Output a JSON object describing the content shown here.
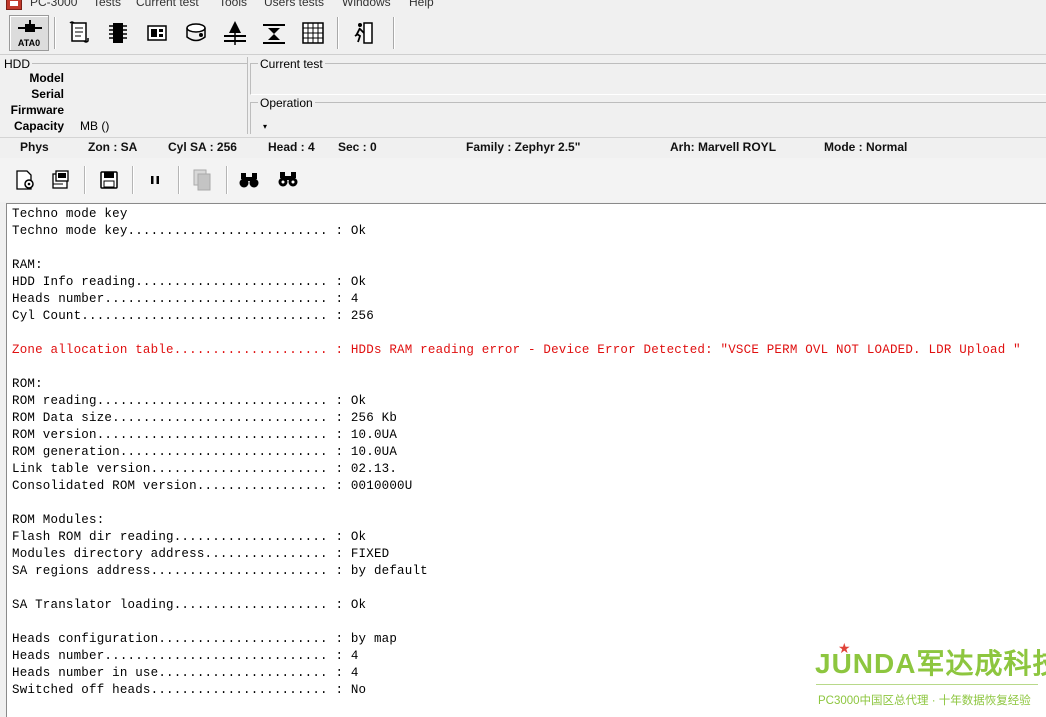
{
  "menu": [
    "PC-3000",
    "Tests",
    "Current test",
    "Tools",
    "Users tests",
    "Windows",
    "Help"
  ],
  "toolbar": {
    "ata_label": "ATA0"
  },
  "hdd": {
    "group_title": "HDD",
    "model_label": "Model",
    "serial_label": "Serial",
    "firmware_label": "Firmware",
    "capacity_label": "Capacity",
    "capacity_value": "MB ()"
  },
  "current_test": {
    "title": "Current test"
  },
  "operation": {
    "title": "Operation",
    "arrow": "▾"
  },
  "status": {
    "phys": "Phys",
    "zone": "Zon : SA",
    "cyl": "Cyl SA : 256",
    "head": "Head : 4",
    "sec": "Sec : 0",
    "family": "Family : Zephyr 2.5\"",
    "arh": "Arh: Marvell ROYL",
    "mode": "Mode : Normal"
  },
  "log": [
    {
      "text": "Techno mode key",
      "error": false
    },
    {
      "text": "Techno mode key.......................... : Ok",
      "error": false
    },
    {
      "text": "",
      "error": false
    },
    {
      "text": "RAM:",
      "error": false
    },
    {
      "text": "HDD Info reading......................... : Ok",
      "error": false
    },
    {
      "text": "Heads number............................. : 4",
      "error": false
    },
    {
      "text": "Cyl Count................................ : 256",
      "error": false
    },
    {
      "text": "",
      "error": false
    },
    {
      "text": "Zone allocation table.................... : HDDs RAM reading error - Device Error Detected: \"VSCE PERM OVL NOT LOADED. LDR Upload \"",
      "error": true
    },
    {
      "text": "",
      "error": false
    },
    {
      "text": "ROM:",
      "error": false
    },
    {
      "text": "ROM reading.............................. : Ok",
      "error": false
    },
    {
      "text": "ROM Data size............................ : 256 Kb",
      "error": false
    },
    {
      "text": "ROM version.............................. : 10.0UA",
      "error": false
    },
    {
      "text": "ROM generation........................... : 10.0UA",
      "error": false
    },
    {
      "text": "Link table version....................... : 02.13.",
      "error": false
    },
    {
      "text": "Consolidated ROM version................. : 0010000U",
      "error": false
    },
    {
      "text": "",
      "error": false
    },
    {
      "text": "ROM Modules:",
      "error": false
    },
    {
      "text": "Flash ROM dir reading.................... : Ok",
      "error": false
    },
    {
      "text": "Modules directory address................ : FIXED",
      "error": false
    },
    {
      "text": "SA regions address....................... : by default",
      "error": false
    },
    {
      "text": "",
      "error": false
    },
    {
      "text": "SA Translator loading.................... : Ok",
      "error": false
    },
    {
      "text": "",
      "error": false
    },
    {
      "text": "Heads configuration...................... : by map",
      "error": false
    },
    {
      "text": "Heads number............................. : 4",
      "error": false
    },
    {
      "text": "Heads number in use...................... : 4",
      "error": false
    },
    {
      "text": "Switched off heads....................... : No",
      "error": false
    }
  ],
  "watermark": {
    "brand": "JUNDA军达成科技",
    "tagline": "PC3000中国区总代理 · 十年数据恢复经验"
  },
  "colors": {
    "error": "#e01010",
    "watermark": "#8dc63f"
  }
}
